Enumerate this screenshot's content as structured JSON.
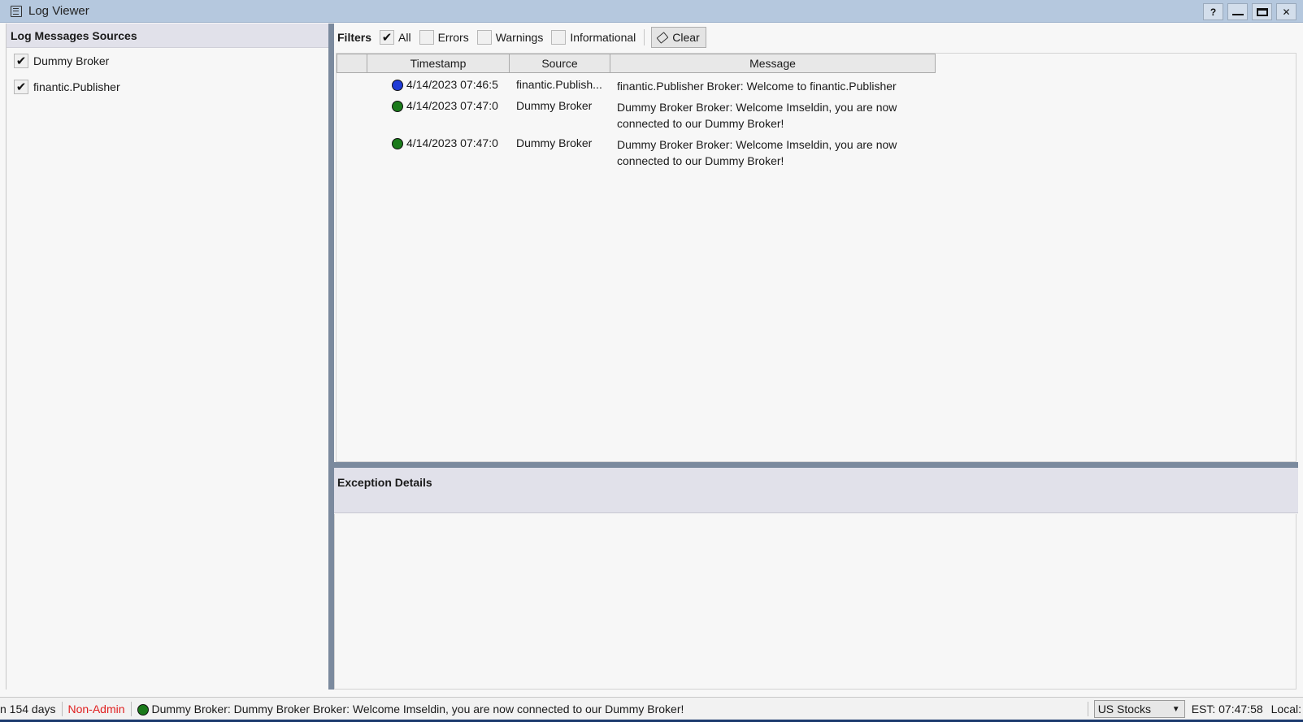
{
  "window": {
    "title": "Log Viewer",
    "help_label": "?",
    "close_label": "✕"
  },
  "sources_panel": {
    "header": "Log Messages Sources",
    "items": [
      {
        "label": "Dummy Broker",
        "checked": true
      },
      {
        "label": "finantic.Publisher",
        "checked": true
      }
    ]
  },
  "filters": {
    "title": "Filters",
    "options": [
      {
        "label": "All",
        "checked": true
      },
      {
        "label": "Errors",
        "checked": false
      },
      {
        "label": "Warnings",
        "checked": false
      },
      {
        "label": "Informational",
        "checked": false
      }
    ],
    "clear_label": "Clear"
  },
  "grid": {
    "columns": [
      "",
      "Timestamp",
      "Source",
      "Message"
    ],
    "rows": [
      {
        "level_color": "#1f3bd6",
        "timestamp": "4/14/2023 07:46:5",
        "source": "finantic.Publish...",
        "message": "finantic.Publisher Broker: Welcome to finantic.Publisher"
      },
      {
        "level_color": "#1b7a1b",
        "timestamp": "4/14/2023 07:47:0",
        "source": "Dummy Broker",
        "message": "Dummy Broker Broker: Welcome Imseldin, you are now connected to our Dummy Broker!"
      },
      {
        "level_color": "#1b7a1b",
        "timestamp": "4/14/2023 07:47:0",
        "source": "Dummy Broker",
        "message": "Dummy Broker Broker: Welcome Imseldin, you are now connected to our Dummy Broker!"
      }
    ]
  },
  "exception_details": {
    "header": "Exception Details"
  },
  "statusbar": {
    "days_text": "n 154 days",
    "role_text": "Non-Admin",
    "message_dot_color": "#1b7a1b",
    "message": "Dummy Broker: Dummy Broker Broker: Welcome Imseldin, you are now connected to our Dummy Broker!",
    "market_select": "US Stocks",
    "est_time": "EST: 07:47:58",
    "local_label": "Local:"
  }
}
